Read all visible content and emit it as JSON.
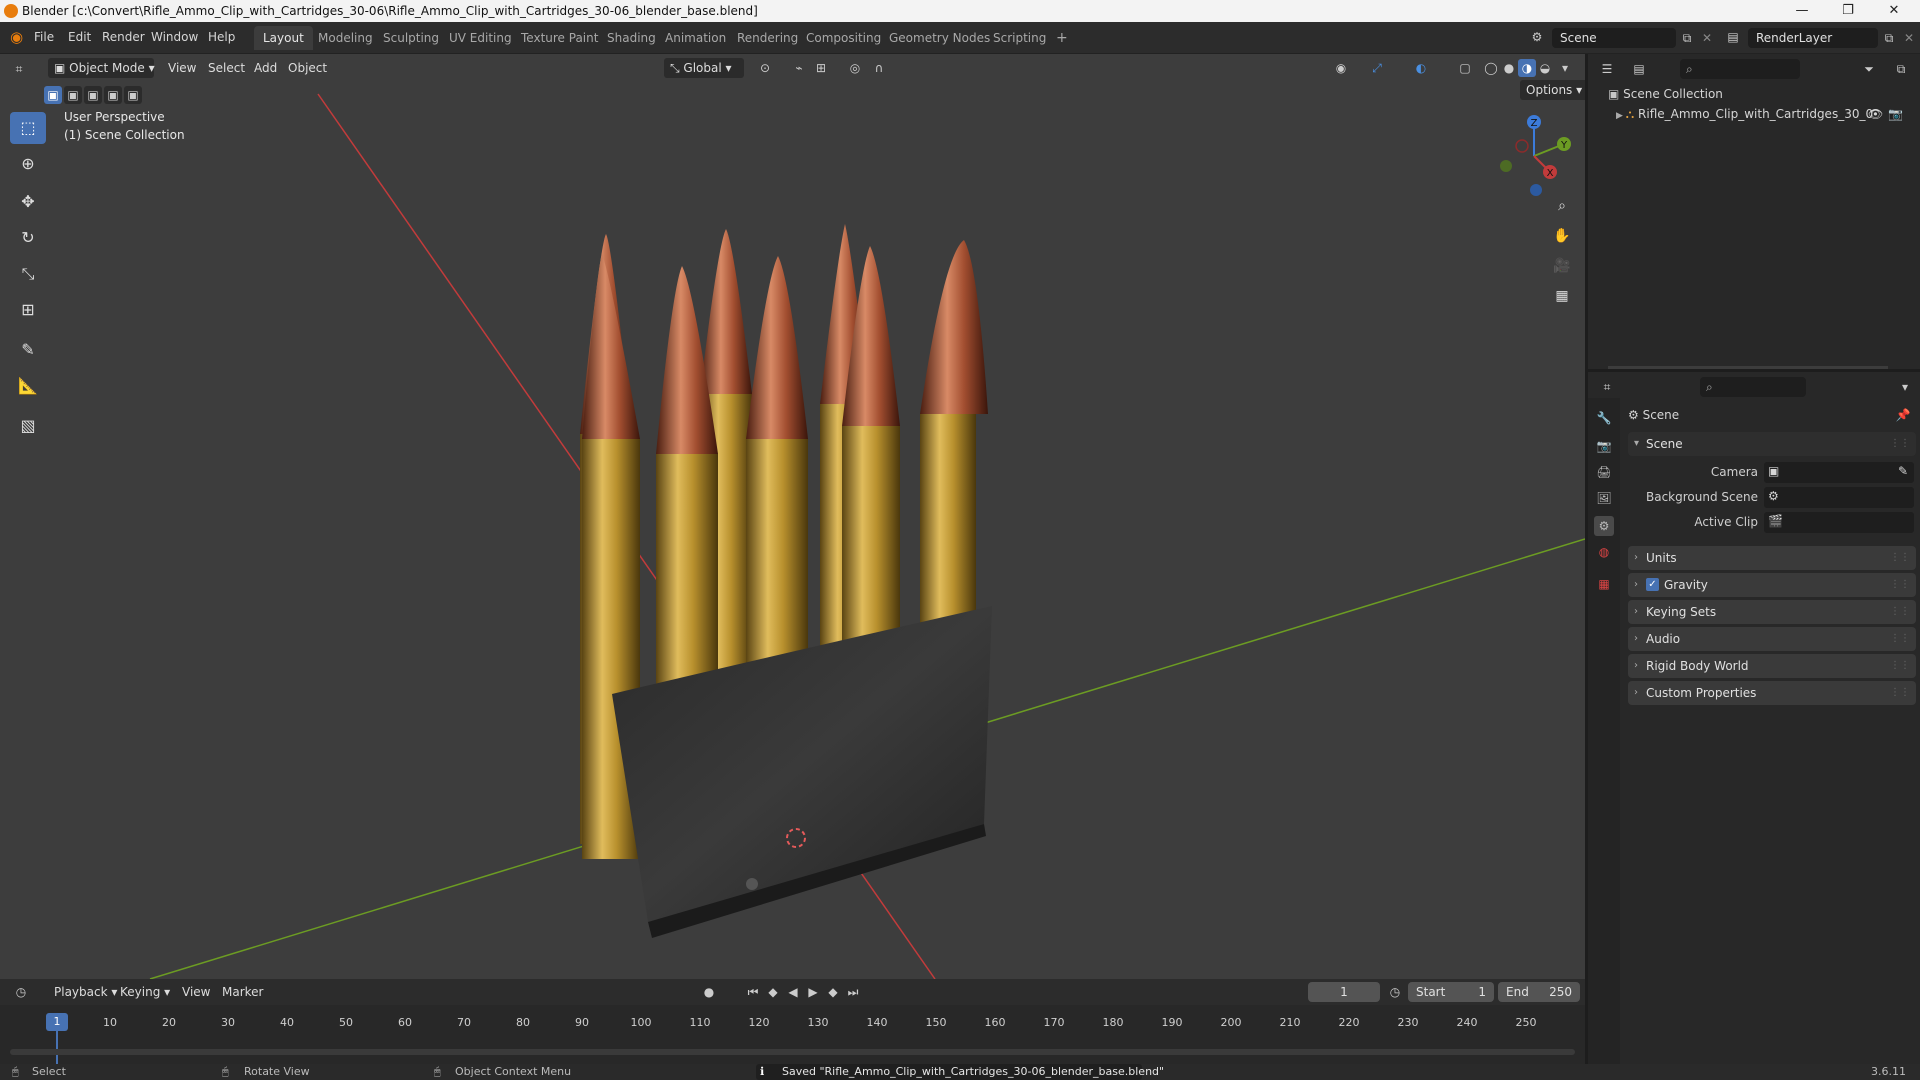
{
  "titlebar": {
    "title": "Blender [c:\\Convert\\Rifle_Ammo_Clip_with_Cartridges_30-06\\Rifle_Ammo_Clip_with_Cartridges_30-06_blender_base.blend]",
    "minimize": "—",
    "restore": "❐",
    "close": "✕"
  },
  "menubar": {
    "items": [
      "File",
      "Edit",
      "Render",
      "Window",
      "Help"
    ],
    "workspaces": [
      "Layout",
      "Modeling",
      "Sculpting",
      "UV Editing",
      "Texture Paint",
      "Shading",
      "Animation",
      "Rendering",
      "Compositing",
      "Geometry Nodes",
      "Scripting"
    ],
    "add_workspace": "+",
    "scene_name": "Scene",
    "view_layer": "RenderLayer"
  },
  "viewport": {
    "mode": "Object Mode",
    "menus": [
      "View",
      "Select",
      "Add",
      "Object"
    ],
    "transform_orientation": "Global",
    "options_label": "Options",
    "overlay_line1": "User Perspective",
    "overlay_line2": "(1) Scene Collection",
    "gizmo_axes": {
      "x": "X",
      "y": "Y",
      "z": "Z"
    }
  },
  "timeline": {
    "menus": [
      "Playback",
      "Keying",
      "View",
      "Marker"
    ],
    "current_frame": "1",
    "start_label": "Start",
    "start_value": "1",
    "end_label": "End",
    "end_value": "250",
    "playhead": "1",
    "ticks": [
      "10",
      "20",
      "30",
      "40",
      "50",
      "60",
      "70",
      "80",
      "90",
      "100",
      "110",
      "120",
      "130",
      "140",
      "150",
      "160",
      "170",
      "180",
      "190",
      "200",
      "210",
      "220",
      "230",
      "240",
      "250"
    ]
  },
  "statusbar": {
    "select": "Select",
    "rotate": "Rotate View",
    "context": "Object Context Menu",
    "message": "Saved \"Rifle_Ammo_Clip_with_Cartridges_30-06_blender_base.blend\"",
    "version": "3.6.11"
  },
  "outliner": {
    "root": "Scene Collection",
    "item": "Rifle_Ammo_Clip_with_Cartridges_30_0"
  },
  "properties": {
    "context_title": "Scene",
    "section_scene": "Scene",
    "camera_label": "Camera",
    "background_scene_label": "Background Scene",
    "active_clip_label": "Active Clip",
    "panels": [
      "Units",
      "Gravity",
      "Keying Sets",
      "Audio",
      "Rigid Body World",
      "Custom Properties"
    ],
    "gravity_checked": true
  },
  "colors": {
    "accent": "#4772b3",
    "viewport_bg": "#3d3d3d",
    "axis_x": "#c23b3b",
    "axis_y": "#6c9c23",
    "brass": "#b8902d",
    "copper": "#a24e30",
    "clip": "#2e2e2e"
  }
}
